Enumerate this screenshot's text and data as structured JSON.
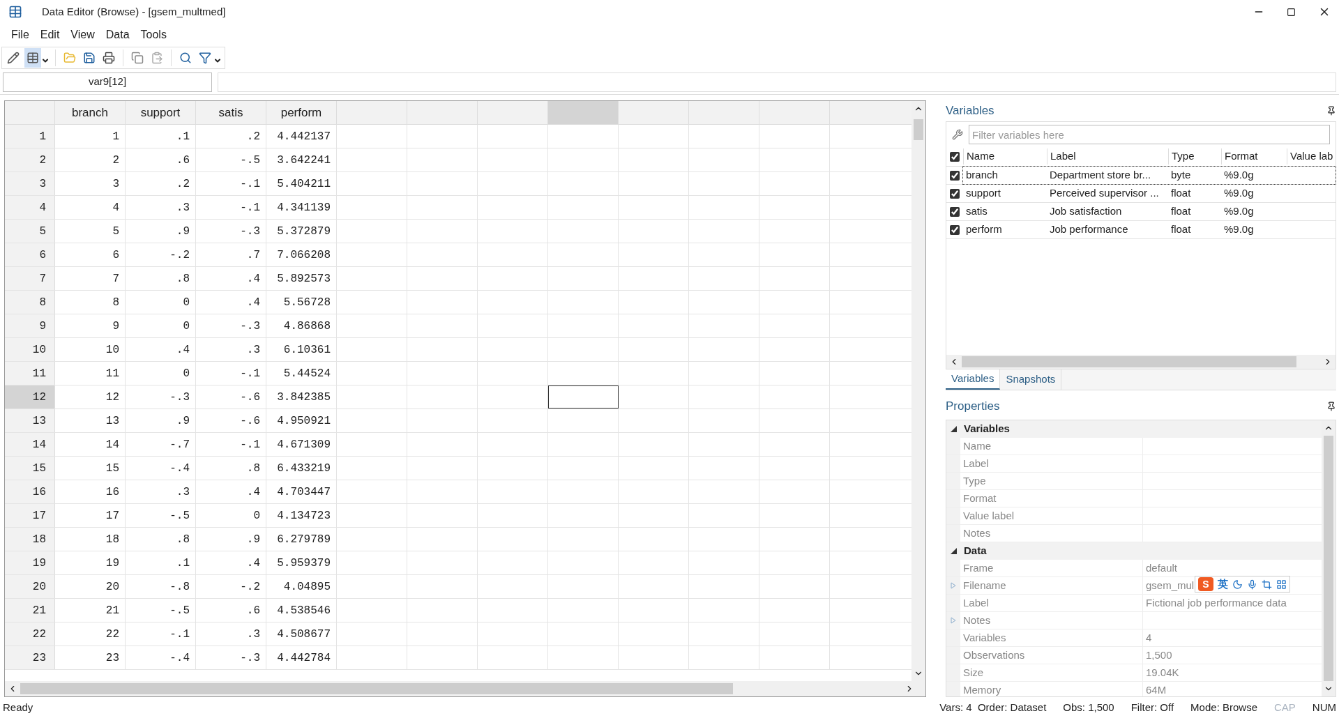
{
  "window": {
    "title": "Data Editor (Browse) - [gsem_multmed]"
  },
  "menu": [
    "File",
    "Edit",
    "View",
    "Data",
    "Tools"
  ],
  "toolbar": [
    {
      "kind": "edit",
      "selected": false
    },
    {
      "kind": "browse",
      "selected": true
    },
    {
      "kind": "open",
      "selected": false
    },
    {
      "kind": "save",
      "selected": false
    },
    {
      "kind": "print",
      "selected": false
    },
    {
      "kind": "copy",
      "selected": false
    },
    {
      "kind": "paste",
      "selected": false
    },
    {
      "kind": "find",
      "selected": false
    },
    {
      "kind": "filter",
      "selected": false
    }
  ],
  "cell_ref": "var9[12]",
  "grid": {
    "columns": [
      {
        "label": "branch",
        "selected": false
      },
      {
        "label": "support",
        "selected": false
      },
      {
        "label": "satis",
        "selected": false
      },
      {
        "label": "perform",
        "selected": false
      },
      {
        "selected": false
      },
      {
        "selected": false
      },
      {
        "selected": false
      },
      {
        "selected": true
      },
      {
        "selected": false
      },
      {
        "selected": false
      },
      {
        "selected": false
      }
    ],
    "rows": [
      {
        "num": "1",
        "cells": [
          "1",
          ".1",
          ".2",
          "4.442137"
        ],
        "selected": false
      },
      {
        "num": "2",
        "cells": [
          "2",
          ".6",
          "-.5",
          "3.642241"
        ],
        "selected": false
      },
      {
        "num": "3",
        "cells": [
          "3",
          ".2",
          "-.1",
          "5.404211"
        ],
        "selected": false
      },
      {
        "num": "4",
        "cells": [
          "4",
          ".3",
          "-.1",
          "4.341139"
        ],
        "selected": false
      },
      {
        "num": "5",
        "cells": [
          "5",
          ".9",
          "-.3",
          "5.372879"
        ],
        "selected": false
      },
      {
        "num": "6",
        "cells": [
          "6",
          "-.2",
          ".7",
          "7.066208"
        ],
        "selected": false
      },
      {
        "num": "7",
        "cells": [
          "7",
          ".8",
          ".4",
          "5.892573"
        ],
        "selected": false
      },
      {
        "num": "8",
        "cells": [
          "8",
          "0",
          ".4",
          "5.56728"
        ],
        "selected": false
      },
      {
        "num": "9",
        "cells": [
          "9",
          "0",
          "-.3",
          "4.86868"
        ],
        "selected": false
      },
      {
        "num": "10",
        "cells": [
          "10",
          ".4",
          ".3",
          "6.10361"
        ],
        "selected": false
      },
      {
        "num": "11",
        "cells": [
          "11",
          "0",
          "-.1",
          "5.44524"
        ],
        "selected": false
      },
      {
        "num": "12",
        "cells": [
          "12",
          "-.3",
          "-.6",
          "3.842385"
        ],
        "selected": true
      },
      {
        "num": "13",
        "cells": [
          "13",
          ".9",
          "-.6",
          "4.950921"
        ],
        "selected": false
      },
      {
        "num": "14",
        "cells": [
          "14",
          "-.7",
          "-.1",
          "4.671309"
        ],
        "selected": false
      },
      {
        "num": "15",
        "cells": [
          "15",
          "-.4",
          ".8",
          "6.433219"
        ],
        "selected": false
      },
      {
        "num": "16",
        "cells": [
          "16",
          ".3",
          ".4",
          "4.703447"
        ],
        "selected": false
      },
      {
        "num": "17",
        "cells": [
          "17",
          "-.5",
          "0",
          "4.134723"
        ],
        "selected": false
      },
      {
        "num": "18",
        "cells": [
          "18",
          ".8",
          ".9",
          "6.279789"
        ],
        "selected": false
      },
      {
        "num": "19",
        "cells": [
          "19",
          ".1",
          ".4",
          "5.959379"
        ],
        "selected": false
      },
      {
        "num": "20",
        "cells": [
          "20",
          "-.8",
          "-.2",
          "4.04895"
        ],
        "selected": false
      },
      {
        "num": "21",
        "cells": [
          "21",
          "-.5",
          ".6",
          "4.538546"
        ],
        "selected": false
      },
      {
        "num": "22",
        "cells": [
          "22",
          "-.1",
          ".3",
          "4.508677"
        ],
        "selected": false
      },
      {
        "num": "23",
        "cells": [
          "23",
          "-.4",
          "-.3",
          "4.442784"
        ],
        "selected": false
      }
    ]
  },
  "variables": {
    "title": "Variables",
    "filter": {
      "placeholder": "Filter variables here"
    },
    "all_checked": true,
    "columns": [
      "Name",
      "Label",
      "Type",
      "Format",
      "Value lab"
    ],
    "rows": [
      {
        "checked": true,
        "selected": true,
        "cells": [
          "branch",
          "Department store br...",
          "byte",
          "%9.0g"
        ]
      },
      {
        "checked": true,
        "selected": false,
        "cells": [
          "support",
          "Perceived supervisor ...",
          "float",
          "%9.0g"
        ]
      },
      {
        "checked": true,
        "selected": false,
        "cells": [
          "satis",
          "Job satisfaction",
          "float",
          "%9.0g"
        ]
      },
      {
        "checked": true,
        "selected": false,
        "cells": [
          "perform",
          "Job performance",
          "float",
          "%9.0g"
        ]
      }
    ]
  },
  "tabs": [
    {
      "label": "Variables",
      "selected": true
    },
    {
      "label": "Snapshots",
      "selected": false
    }
  ],
  "properties": {
    "title": "Properties",
    "sections": [
      {
        "title": "Variables",
        "expanded": true,
        "rows": [
          {
            "name": "Name",
            "expandable": false
          },
          {
            "name": "Label",
            "expandable": false
          },
          {
            "name": "Type",
            "expandable": false
          },
          {
            "name": "Format",
            "expandable": false
          },
          {
            "name": "Value label",
            "expandable": false
          },
          {
            "name": "Notes",
            "expandable": false
          }
        ]
      },
      {
        "title": "Data",
        "expanded": true,
        "rows": [
          {
            "name": "Frame",
            "value": "default",
            "expandable": false
          },
          {
            "name": "Filename",
            "value": "gsem_mul",
            "expandable": true
          },
          {
            "name": "Label",
            "value": "Fictional job performance data",
            "expandable": false
          },
          {
            "name": "Notes",
            "expandable": true
          },
          {
            "name": "Variables",
            "value": "4",
            "expandable": false
          },
          {
            "name": "Observations",
            "value": "1,500",
            "expandable": false
          },
          {
            "name": "Size",
            "value": "19.04K",
            "expandable": false
          },
          {
            "name": "Memory",
            "value": "64M",
            "expandable": false
          }
        ]
      }
    ]
  },
  "ime_bar": {
    "logo": "S",
    "mode": "英"
  },
  "status_bar": {
    "left": "Ready",
    "items": [
      {
        "text": "Vars: 4  Order: Dataset",
        "dim": false
      },
      {
        "text": "Obs: 1,500",
        "dim": false
      },
      {
        "text": "Filter: Off",
        "dim": false
      },
      {
        "text": "Mode: Browse",
        "dim": false
      },
      {
        "text": "CAP",
        "dim": true
      },
      {
        "text": "NUM",
        "dim": false
      }
    ]
  }
}
